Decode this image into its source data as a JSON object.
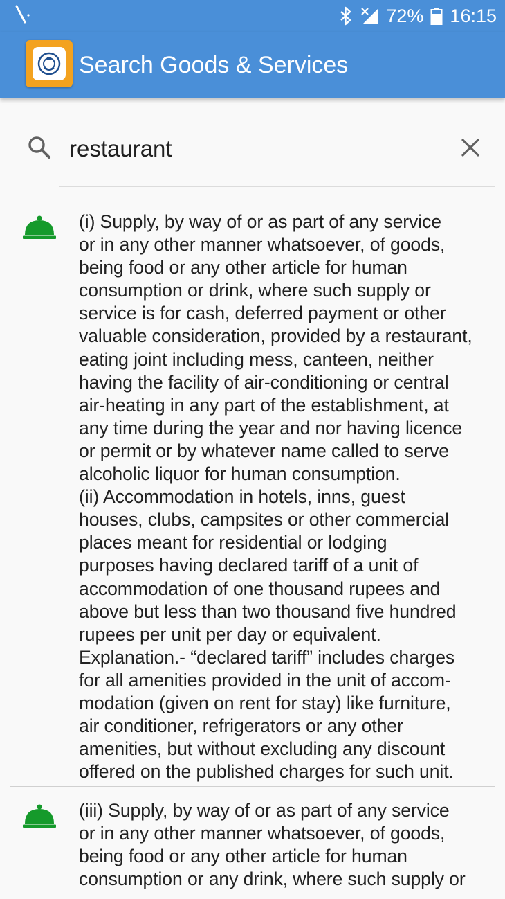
{
  "status_bar": {
    "battery": "72%",
    "time": "16:15",
    "icons": [
      "signal-glyph-icon",
      "bluetooth-icon",
      "cellular-signal-icon",
      "battery-icon"
    ]
  },
  "app_bar": {
    "title": "Search Goods & Services",
    "logo": "emblem-logo"
  },
  "search": {
    "query": "restaurant",
    "icons": [
      "search-icon",
      "clear-icon"
    ]
  },
  "colors": {
    "primary": "#4a8fd8",
    "logo_bg": "#f3a21f",
    "result_icon": "#159a2b"
  },
  "results": [
    {
      "icon": "service-bell-icon",
      "text": "(i) Supply, by way of or as part of any service\nor in any other manner whatsoever, of goods,\nbeing food or any other article for human\nconsumption or drink, where such supply or\nservice is for cash, deferred payment or other\nvaluable consideration, provided by a restaurant,\neating joint including mess, canteen, neither\nhaving the facility of air-conditioning or central\nair-heating in any part of the establishment, at\nany time during the year and nor having licence\nor permit or by whatever name called to serve\nalcoholic liquor for human consumption.\n(ii) Accommodation in hotels, inns, guest\nhouses, clubs, campsites or other commercial\nplaces meant for residential or lodging\npurposes having declared tariff of a unit of\naccommodation of one thousand rupees and\nabove but less than two  thousand five hundred\nrupees per unit per day or equivalent.\nExplanation.- “declared tariff” includes charges\nfor all amenities provided in the unit of accom-\nmodation (given on rent for stay) like furniture,\nair conditioner, refrigerators or any other\namenities, but without excluding any discount\noffered on the published charges for such unit."
    },
    {
      "icon": "service-bell-icon",
      "text": "(iii) Supply, by way of or as part of any service\nor in any other manner whatsoever, of goods,\nbeing food or any other article for human\nconsumption or any drink, where such supply or"
    }
  ]
}
